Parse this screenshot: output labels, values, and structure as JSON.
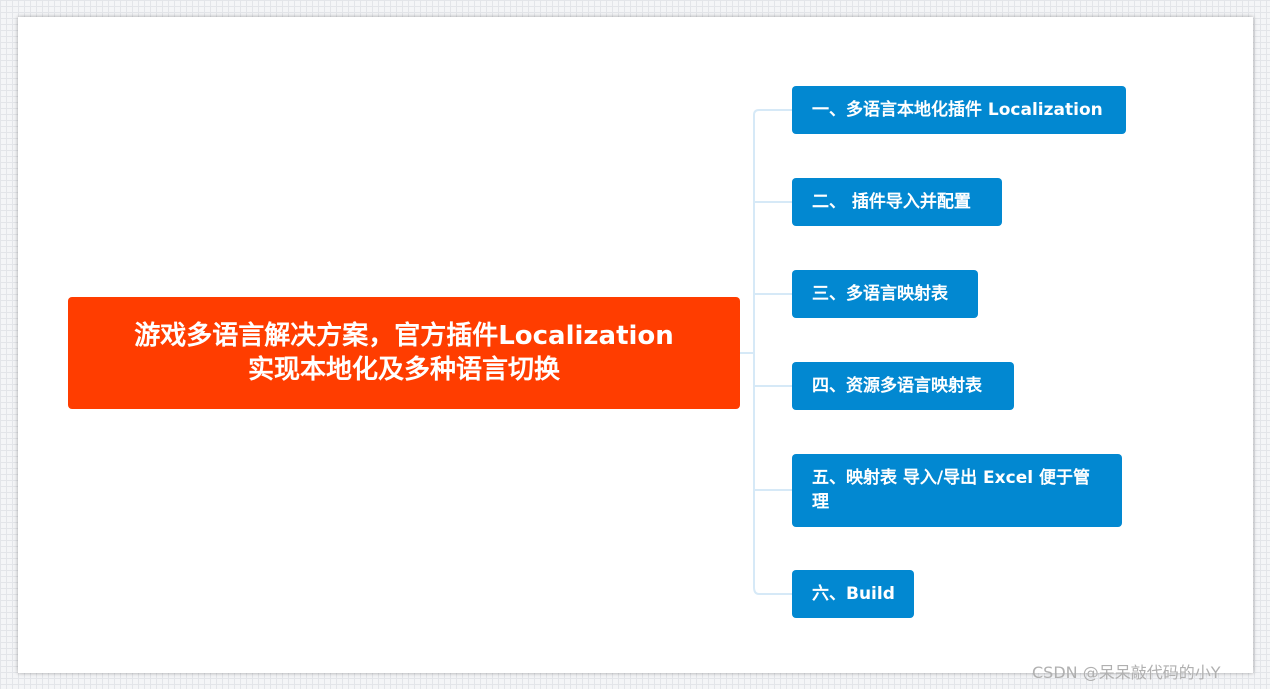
{
  "colors": {
    "root_bg": "#ff3d00",
    "branch_bg": "#0288d1",
    "connector": "#d6e9f7"
  },
  "root": {
    "title": "游戏多语言解决方案，官方插件Localization\n实现本地化及多种语言切换"
  },
  "branches": [
    {
      "label": "一、多语言本地化插件 Localization"
    },
    {
      "label": "二、 插件导入并配置"
    },
    {
      "label": "三、多语言映射表"
    },
    {
      "label": "四、资源多语言映射表"
    },
    {
      "label": "五、映射表 导入/导出 Excel 便于管理"
    },
    {
      "label": "六、Build"
    }
  ],
  "watermark": "CSDN @呆呆敲代码的小Y"
}
